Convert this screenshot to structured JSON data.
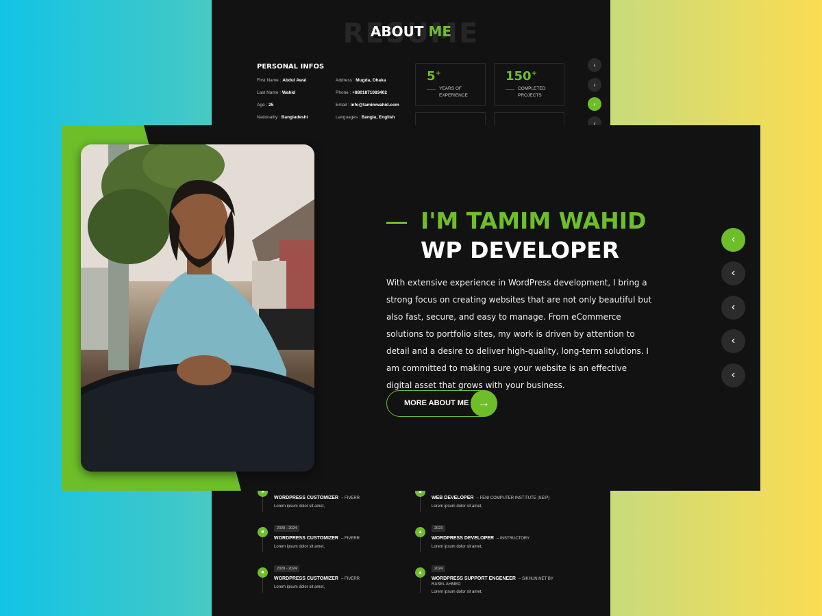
{
  "about": {
    "ghost_text": "RESUME",
    "title_word": "ABOUT",
    "title_accent": "ME"
  },
  "personal": {
    "heading": "PERSONAL INFOS",
    "left": [
      {
        "label": "First Name :",
        "value": "Abdul Awal"
      },
      {
        "label": "Last Name :",
        "value": "Wahid"
      },
      {
        "label": "Age :",
        "value": "25"
      },
      {
        "label": "Nationality :",
        "value": "Bangladeshi"
      }
    ],
    "right": [
      {
        "label": "Address :",
        "value": "Mugda, Dhaka"
      },
      {
        "label": "Phone :",
        "value": "+8801871083402"
      },
      {
        "label": "Email :",
        "value": "info@tamimwahid.com"
      },
      {
        "label": "Languages :",
        "value": "Bangla, English"
      }
    ]
  },
  "stats": [
    {
      "number": "5+",
      "label_1": "YEARS OF",
      "label_2": "EXPERIENCE"
    },
    {
      "number": "150+",
      "label_1": "COMPLETED",
      "label_2": "PROJECTS"
    }
  ],
  "hero": {
    "name": "I'M TAMIM WAHID",
    "role": "WP DEVELOPER",
    "bio": "With extensive experience in WordPress development, I bring a strong focus on creating websites that are not only beautiful but also fast, secure, and easy to manage. From eCommerce solutions to portfolio sites, my work is driven by attention to detail and a desire to deliver high-quality, long-term solutions. I am committed to making sure your website is an effective digital asset that grows with your business.",
    "button_label": "MORE ABOUT ME",
    "button_icon": "arrow-right-icon",
    "nav_icon": "chevron-left-icon"
  },
  "timeline": {
    "left": [
      {
        "date": "",
        "title": "WORDPRESS CUSTOMIZER",
        "org": "FIVERR",
        "desc": "Lorem ipsum dolor sit amet,"
      },
      {
        "date": "2020 - 2024",
        "title": "WORDPRESS CUSTOMIZER",
        "org": "FIVERR",
        "desc": "Lorem ipsum dolor sit amet,"
      },
      {
        "date": "2020 - 2024",
        "title": "WORDPRESS CUSTOMIZER",
        "org": "FIVERR",
        "desc": "Lorem ipsum dolor sit amet,"
      }
    ],
    "right": [
      {
        "date": "",
        "title": "WEB DEVELOPER",
        "org": "FENI COMPUTER INSTITUTE (SEIP)",
        "desc": "Lorem ipsum dolor sit amet,"
      },
      {
        "date": "2023",
        "title": "WORDPRESS DEVELOPER",
        "org": "INSTRUCTORY",
        "desc": "Lorem ipsum dolor sit amet,"
      },
      {
        "date": "2024",
        "title": "WORDPRESS SUPPORT ENGENEER",
        "org": "SIKHUN.NET BY",
        "org_2": "RASEL AHMED",
        "desc": "Lorem ipsum dolor sit amet,"
      }
    ]
  },
  "colors": {
    "accent": "#6ebe2a",
    "panel": "#121212"
  }
}
